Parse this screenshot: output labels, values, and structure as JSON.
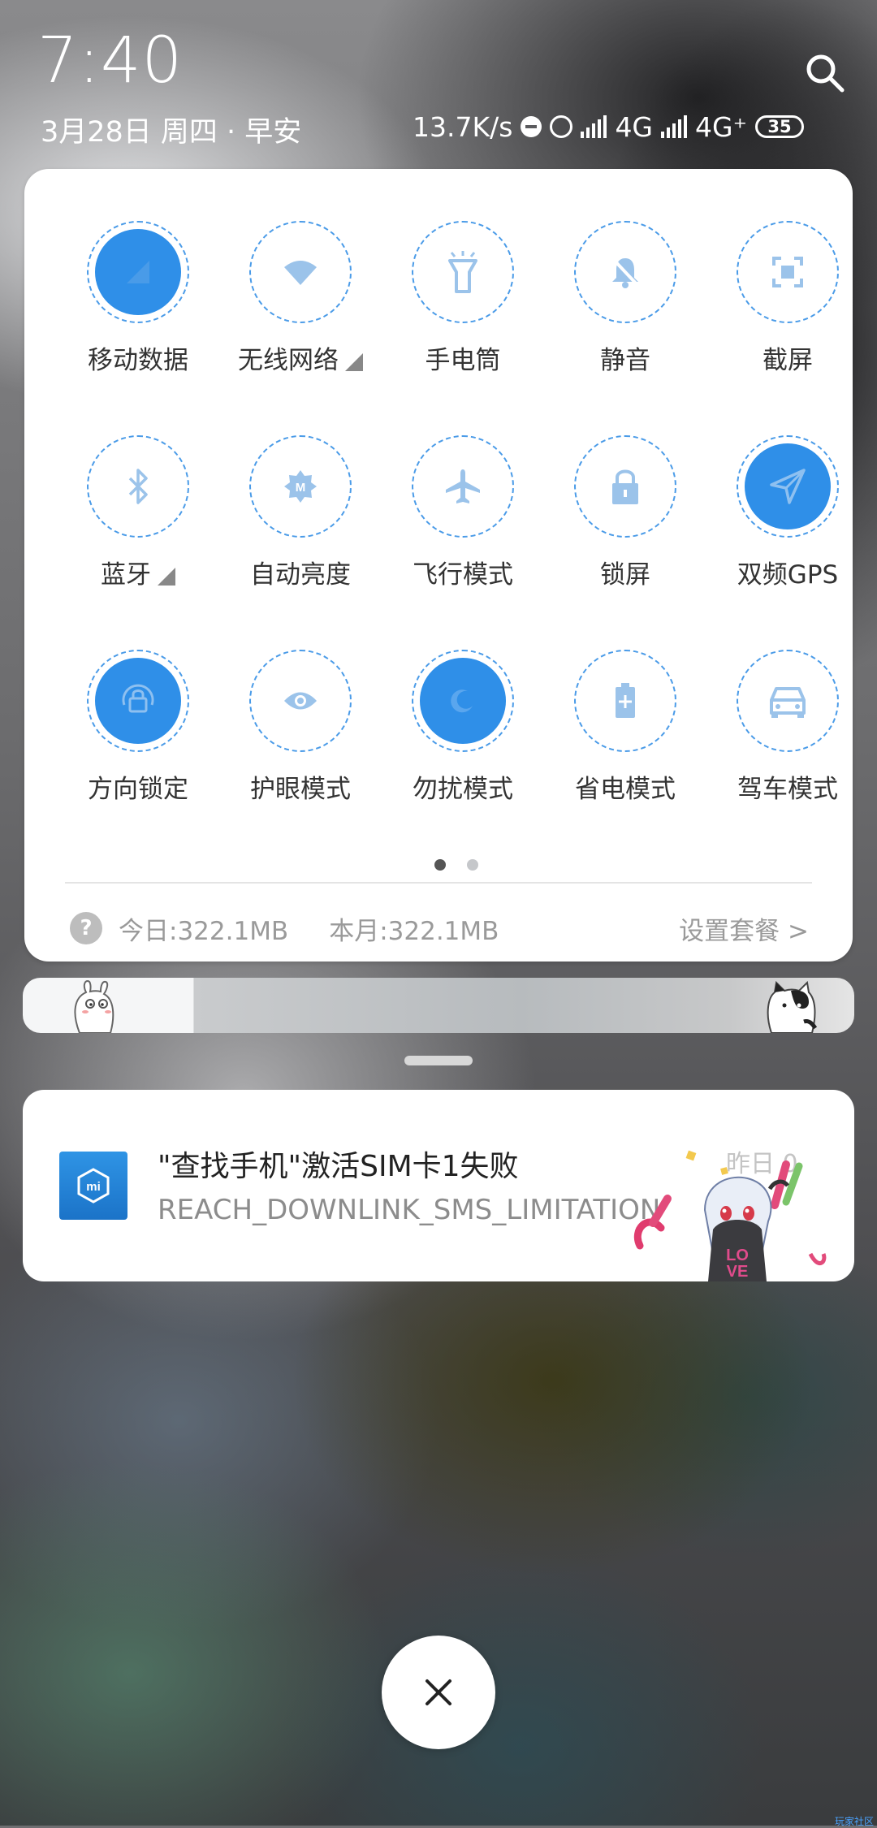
{
  "status": {
    "time": "7:40",
    "date": "3月28日 周四 · 早安",
    "net_speed": "13.7K/s",
    "network1": "4G",
    "network2": "4G⁺",
    "battery": "35"
  },
  "tiles": [
    {
      "label": "移动数据",
      "on": true,
      "icon": "mobile-data-icon"
    },
    {
      "label": "无线网络",
      "on": false,
      "icon": "wifi-icon",
      "more": true
    },
    {
      "label": "手电筒",
      "on": false,
      "icon": "flashlight-icon"
    },
    {
      "label": "静音",
      "on": false,
      "icon": "mute-icon"
    },
    {
      "label": "截屏",
      "on": false,
      "icon": "screenshot-icon"
    },
    {
      "label": "蓝牙",
      "on": false,
      "icon": "bluetooth-icon",
      "more": true
    },
    {
      "label": "自动亮度",
      "on": false,
      "icon": "auto-brightness-icon"
    },
    {
      "label": "飞行模式",
      "on": false,
      "icon": "airplane-icon"
    },
    {
      "label": "锁屏",
      "on": false,
      "icon": "lock-icon"
    },
    {
      "label": "双频GPS",
      "on": true,
      "icon": "gps-icon"
    },
    {
      "label": "方向锁定",
      "on": true,
      "icon": "rotation-lock-icon"
    },
    {
      "label": "护眼模式",
      "on": false,
      "icon": "eye-icon"
    },
    {
      "label": "勿扰模式",
      "on": true,
      "icon": "dnd-icon"
    },
    {
      "label": "省电模式",
      "on": false,
      "icon": "battery-saver-icon"
    },
    {
      "label": "驾车模式",
      "on": false,
      "icon": "car-icon"
    }
  ],
  "page_indicator": {
    "current": 1,
    "total": 2
  },
  "usage": {
    "help": "?",
    "today": "今日:322.1MB",
    "month": "本月:322.1MB",
    "plan_link": "设置套餐 >"
  },
  "notification": {
    "title": "\"查找手机\"激活SIM卡1失败",
    "body": "REACH_DOWNLINK_SMS_LIMITATION",
    "time": "昨日 0",
    "app_icon": "mi-icon"
  },
  "close_label": "×",
  "watermark": "玩家社区",
  "colors": {
    "accent": "#2f8fe8",
    "dash": "#4a9be8",
    "icon": "#9bc3ea"
  }
}
